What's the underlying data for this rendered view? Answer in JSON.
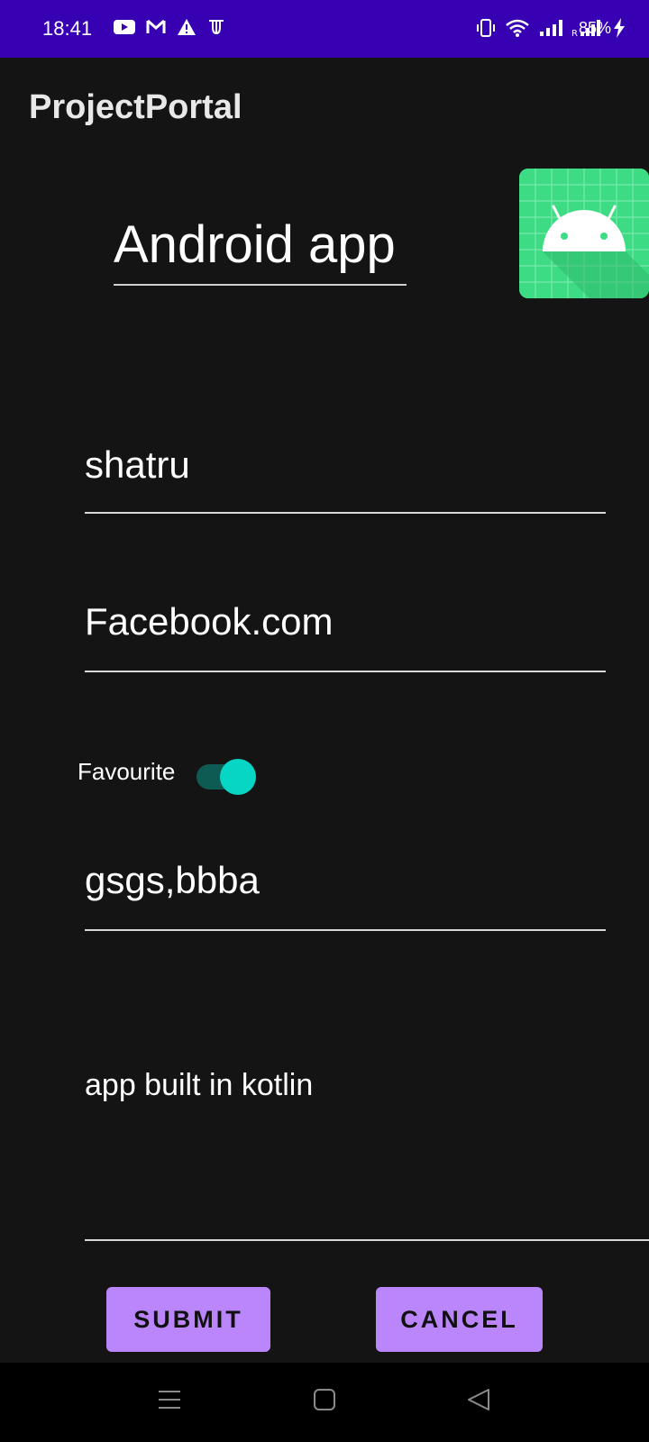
{
  "status_bar": {
    "time": "18:41",
    "battery": "85%",
    "left_icons": [
      "youtube-icon",
      "gmail-icon",
      "warning-icon",
      "app-t-icon"
    ],
    "right_icons": [
      "vibrate-icon",
      "wifi-icon",
      "signal-icon",
      "roaming-signal-icon",
      "charging-icon"
    ],
    "roaming_label": "R"
  },
  "app_bar": {
    "title": "ProjectPortal"
  },
  "form": {
    "project_name": "Android app",
    "author": "shatru",
    "url": "Facebook.com",
    "favourite_label": "Favourite",
    "favourite_on": true,
    "tags": "gsgs,bbba",
    "description": "app built in kotlin"
  },
  "buttons": {
    "submit": "SUBMIT",
    "cancel": "CANCEL"
  },
  "colors": {
    "status_bar": "#3700b3",
    "background": "#141414",
    "button": "#bb86fc",
    "switch_thumb": "#08d6c4",
    "switch_track": "#0e5b54",
    "android_green": "#3ddc84"
  },
  "nav_bar": {
    "icons": [
      "menu-icon",
      "home-icon",
      "back-icon"
    ]
  }
}
